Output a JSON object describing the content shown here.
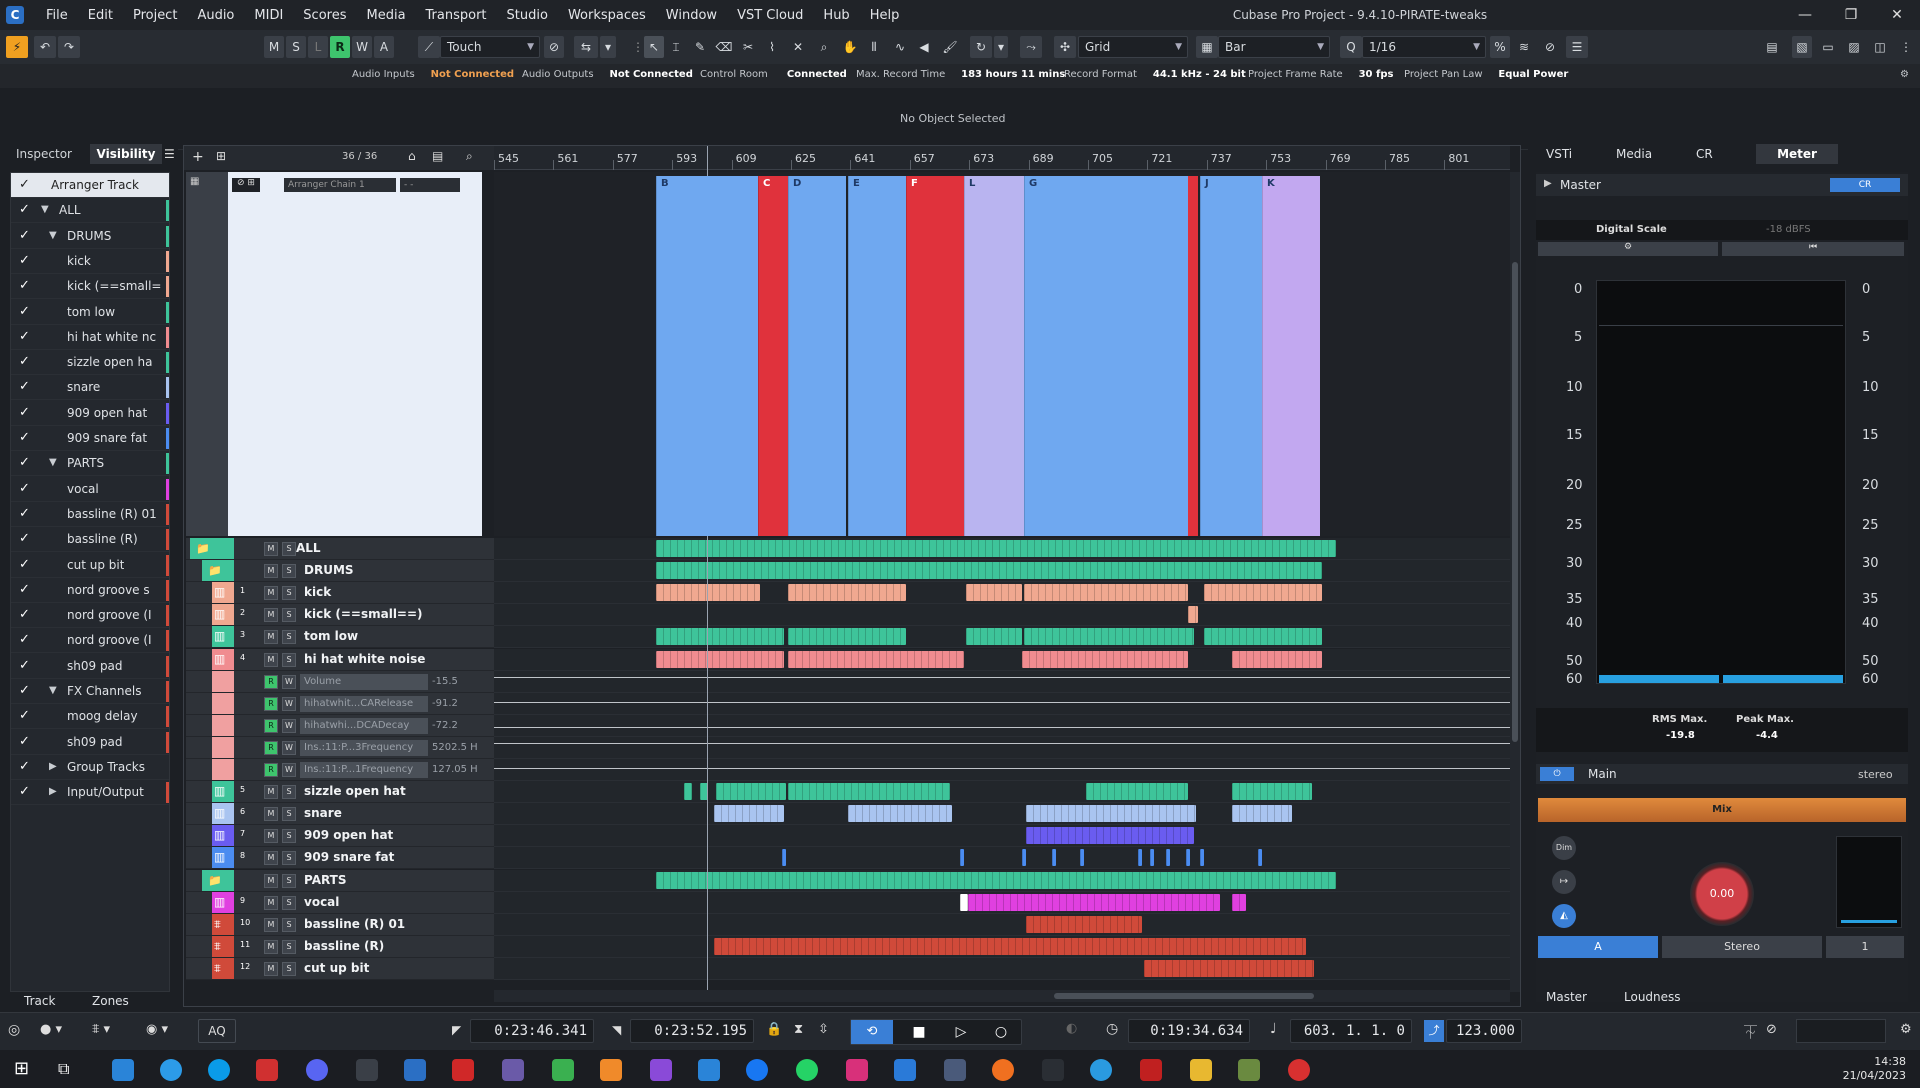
{
  "menu": [
    "File",
    "Edit",
    "Project",
    "Audio",
    "MIDI",
    "Scores",
    "Media",
    "Transport",
    "Studio",
    "Workspaces",
    "Window",
    "VST Cloud",
    "Hub",
    "Help"
  ],
  "window_title": "Cubase Pro Project - 9.4.10-PIRATE-tweaks",
  "toolbar": {
    "m": "M",
    "s": "S",
    "l": "L",
    "r": "R",
    "w": "W",
    "a": "A",
    "automation_mode": "Touch",
    "snap_type": "Grid",
    "grid_type": "Bar",
    "quantize": "1/16"
  },
  "status": {
    "audio_inputs_label": "Audio Inputs",
    "audio_inputs_value": "Not Connected",
    "audio_outputs_label": "Audio Outputs",
    "audio_outputs_value": "Not Connected",
    "control_room_label": "Control Room",
    "control_room_value": "Connected",
    "max_record_label": "Max. Record Time",
    "max_record_value": "183 hours 11 mins",
    "record_format_label": "Record Format",
    "record_format_value": "44.1 kHz - 24 bit",
    "frame_rate_label": "Project Frame Rate",
    "frame_rate_value": "30 fps",
    "pan_law_label": "Project Pan Law",
    "pan_law_value": "Equal Power"
  },
  "info_line": "No Object Selected",
  "inspector": {
    "tab_inspector": "Inspector",
    "tab_visibility": "Visibility",
    "bottom_track": "Track",
    "bottom_zones": "Zones",
    "items": [
      {
        "label": "Arranger Track",
        "indent": 0,
        "tri": "",
        "color": ""
      },
      {
        "label": "ALL",
        "indent": 1,
        "tri": "▼",
        "color": "#3ec49a"
      },
      {
        "label": "DRUMS",
        "indent": 2,
        "tri": "▼",
        "color": "#3ec49a"
      },
      {
        "label": "kick",
        "indent": 3,
        "tri": "",
        "color": "#f0a890"
      },
      {
        "label": "kick (==small=",
        "indent": 3,
        "tri": "",
        "color": "#f0a890"
      },
      {
        "label": "tom low",
        "indent": 3,
        "tri": "",
        "color": "#3ec49a"
      },
      {
        "label": "hi hat white nc",
        "indent": 3,
        "tri": "",
        "color": "#f08c90"
      },
      {
        "label": "sizzle open ha",
        "indent": 3,
        "tri": "",
        "color": "#3ec49a"
      },
      {
        "label": "snare",
        "indent": 3,
        "tri": "",
        "color": "#a9c4f0"
      },
      {
        "label": "909 open hat",
        "indent": 3,
        "tri": "",
        "color": "#6a5cf0"
      },
      {
        "label": "909 snare fat",
        "indent": 3,
        "tri": "",
        "color": "#4b8cf0"
      },
      {
        "label": "PARTS",
        "indent": 2,
        "tri": "▼",
        "color": "#3ec49a"
      },
      {
        "label": "vocal",
        "indent": 3,
        "tri": "",
        "color": "#e040e0"
      },
      {
        "label": "bassline (R) 01",
        "indent": 3,
        "tri": "",
        "color": "#d04a3a"
      },
      {
        "label": "bassline (R)",
        "indent": 3,
        "tri": "",
        "color": "#d04a3a"
      },
      {
        "label": "cut up bit",
        "indent": 3,
        "tri": "",
        "color": "#d04a3a"
      },
      {
        "label": "nord groove s",
        "indent": 3,
        "tri": "",
        "color": "#d04a3a"
      },
      {
        "label": "nord groove (I",
        "indent": 3,
        "tri": "",
        "color": "#d04a3a"
      },
      {
        "label": "nord groove (I",
        "indent": 3,
        "tri": "",
        "color": "#d04a3a"
      },
      {
        "label": "sh09 pad",
        "indent": 3,
        "tri": "",
        "color": "#d04a3a"
      },
      {
        "label": "FX Channels",
        "indent": 2,
        "tri": "▼",
        "color": "#d04a3a"
      },
      {
        "label": "moog delay",
        "indent": 3,
        "tri": "",
        "color": "#d04a3a"
      },
      {
        "label": "sh09 pad",
        "indent": 3,
        "tri": "",
        "color": "#d04a3a"
      },
      {
        "label": "Group Tracks",
        "indent": 2,
        "tri": "▶",
        "color": ""
      },
      {
        "label": "Input/Output",
        "indent": 2,
        "tri": "▶",
        "color": "#d04a3a"
      }
    ]
  },
  "project": {
    "track_count": "36 / 36",
    "arranger_chain": "Arranger Chain 1",
    "ruler": [
      "545",
      "561",
      "577",
      "593",
      "609",
      "625",
      "641",
      "657",
      "673",
      "689",
      "705",
      "721",
      "737",
      "753",
      "769",
      "785",
      "801"
    ],
    "arranger_sections": [
      {
        "tag": "B",
        "color": "#6fa8f0"
      },
      {
        "tag": "C",
        "color": "#e0323c"
      },
      {
        "tag": "D",
        "color": "#6fa8f0"
      },
      {
        "tag": "E",
        "color": "#6fa8f0"
      },
      {
        "tag": "F",
        "color": "#e0323c"
      },
      {
        "tag": "L",
        "color": "#b9b4f0"
      },
      {
        "tag": "G",
        "color": "#6fa8f0"
      },
      {
        "tag": "J",
        "color": "#6fa8f0"
      },
      {
        "tag": "K",
        "color": "#c2a8f0"
      }
    ],
    "tracks": [
      {
        "name": "ALL",
        "num": "",
        "kind": "folder",
        "color": "#3ec49a"
      },
      {
        "name": "DRUMS",
        "num": "",
        "kind": "folder",
        "color": "#3ec49a"
      },
      {
        "name": "kick",
        "num": "1",
        "kind": "midi",
        "color": "#f0a890"
      },
      {
        "name": "kick (==small==)",
        "num": "2",
        "kind": "midi",
        "color": "#f0a890"
      },
      {
        "name": "tom low",
        "num": "3",
        "kind": "midi",
        "color": "#3ec49a"
      },
      {
        "name": "hi hat white noise",
        "num": "4",
        "kind": "midi",
        "color": "#f08c90"
      },
      {
        "name": "Volume",
        "num": "",
        "kind": "auto",
        "value": "-15.5",
        "color": "#f0a0a0"
      },
      {
        "name": "hihatwhit...CARelease",
        "num": "",
        "kind": "auto",
        "value": "-91.2",
        "color": "#f0a0a0"
      },
      {
        "name": "hihatwhi...DCADecay",
        "num": "",
        "kind": "auto",
        "value": "-72.2",
        "color": "#f0a0a0"
      },
      {
        "name": "Ins.:11:P...3Frequency",
        "num": "",
        "kind": "auto",
        "value": "5202.5 H",
        "color": "#f0a0a0"
      },
      {
        "name": "Ins.:11:P...1Frequency",
        "num": "",
        "kind": "auto",
        "value": "127.05 H",
        "color": "#f0a0a0"
      },
      {
        "name": "sizzle open hat",
        "num": "5",
        "kind": "midi",
        "color": "#3ec49a"
      },
      {
        "name": "snare",
        "num": "6",
        "kind": "midi",
        "color": "#a9c4f0"
      },
      {
        "name": "909 open hat",
        "num": "7",
        "kind": "midi",
        "color": "#6a5cf0"
      },
      {
        "name": "909 snare fat",
        "num": "8",
        "kind": "midi",
        "color": "#4b8cf0"
      },
      {
        "name": "PARTS",
        "num": "",
        "kind": "folder",
        "color": "#3ec49a"
      },
      {
        "name": "vocal",
        "num": "9",
        "kind": "midi",
        "color": "#e040e0"
      },
      {
        "name": "bassline (R) 01",
        "num": "10",
        "kind": "audio",
        "color": "#d04a3a"
      },
      {
        "name": "bassline (R)",
        "num": "11",
        "kind": "audio",
        "color": "#d04a3a"
      },
      {
        "name": "cut up bit",
        "num": "12",
        "kind": "audio",
        "color": "#d04a3a"
      }
    ]
  },
  "rightzone": {
    "tabs": [
      "VSTi",
      "Media",
      "CR",
      "Meter"
    ],
    "master_label": "Master",
    "master_btn": "CR",
    "digital_scale": "Digital Scale",
    "dbfs": "-18 dBFS",
    "scale": [
      "0",
      "5",
      "10",
      "15",
      "20",
      "25",
      "30",
      "35",
      "40",
      "50",
      "60"
    ],
    "rms_label": "RMS Max.",
    "rms_value": "-19.8",
    "peak_label": "Peak Max.",
    "peak_value": "-4.4",
    "main_label": "Main",
    "stereo_label": "stereo",
    "mix_label": "Mix",
    "dim_label": "Dim",
    "knob_value": "0.00",
    "a_label": "A",
    "stereo_btn": "Stereo",
    "one_label": "1",
    "bottom_master": "Master",
    "bottom_loudness": "Loudness"
  },
  "transport": {
    "left_locator": "0:23:46.341",
    "right_locator": "0:23:52.195",
    "time": "0:19:34.634",
    "bars": "603. 1. 1.   0",
    "tempo": "123.000",
    "aq": "AQ"
  },
  "taskbar": {
    "time": "14:38",
    "date": "21/04/2023"
  }
}
